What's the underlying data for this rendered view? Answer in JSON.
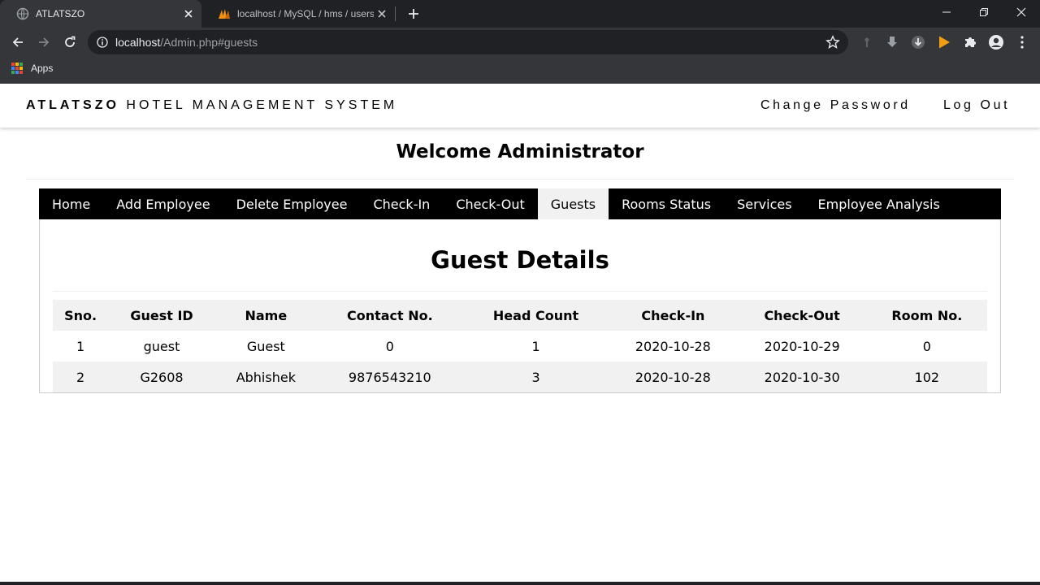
{
  "browser": {
    "tabs": [
      {
        "title": "ATLATSZO",
        "active": true
      },
      {
        "title": "localhost / MySQL / hms / users | ph",
        "active": false
      }
    ],
    "url_host": "localhost",
    "url_path": "/Admin.php#guests",
    "bookmarks": {
      "apps_label": "Apps"
    }
  },
  "header": {
    "brand_bold": "ATLATSZO",
    "brand_rest": " HOTEL MANAGEMENT SYSTEM",
    "change_password": "Change Password",
    "log_out": "Log Out"
  },
  "welcome": "Welcome Administrator",
  "nav": {
    "items": [
      {
        "label": "Home",
        "active": false
      },
      {
        "label": "Add Employee",
        "active": false
      },
      {
        "label": "Delete Employee",
        "active": false
      },
      {
        "label": "Check-In",
        "active": false
      },
      {
        "label": "Check-Out",
        "active": false
      },
      {
        "label": "Guests",
        "active": true
      },
      {
        "label": "Rooms Status",
        "active": false
      },
      {
        "label": "Services",
        "active": false
      },
      {
        "label": "Employee Analysis",
        "active": false
      }
    ]
  },
  "guests": {
    "title": "Guest Details",
    "columns": [
      "Sno.",
      "Guest ID",
      "Name",
      "Contact No.",
      "Head Count",
      "Check-In",
      "Check-Out",
      "Room No."
    ],
    "rows": [
      [
        "1",
        "guest",
        "Guest",
        "0",
        "1",
        "2020-10-28",
        "2020-10-29",
        "0"
      ],
      [
        "2",
        "G2608",
        "Abhishek",
        "9876543210",
        "3",
        "2020-10-28",
        "2020-10-30",
        "102"
      ]
    ]
  },
  "colors": {
    "nav_bg": "#000000",
    "nav_active_bg": "#f1f1f1",
    "table_stripe": "#f1f1f1",
    "chrome_dark": "#202124",
    "chrome_toolbar": "#35363a"
  }
}
